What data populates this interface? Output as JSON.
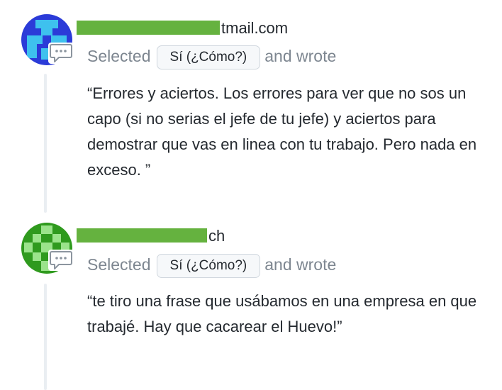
{
  "comments": [
    {
      "user_suffix": "tmail.com",
      "selected_label": "Selected",
      "option_label": "Sí (¿Cómo?)",
      "wrote_label": "and wrote",
      "text": "“Errores y aciertos. Los errores para ver que no sos un capo (si no serias el jefe de tu jefe) y aciertos para demostrar que vas en linea con tu trabajo. Pero nada en exceso. ”",
      "avatar_color": "#2b3bd8",
      "avatar_accent": "#3ec1ee",
      "icon": "comment-bubble-icon"
    },
    {
      "user_suffix": "ch",
      "selected_label": "Selected",
      "option_label": "Sí (¿Cómo?)",
      "wrote_label": "and wrote",
      "text": "“te tiro una frase que usábamos en una empresa en que trabajé. Hay que cacarear el Huevo!”",
      "avatar_color": "#2f9a1e",
      "avatar_accent": "#9be38b",
      "icon": "comment-bubble-icon"
    }
  ],
  "colors": {
    "redaction": "#65b23f",
    "muted_text": "#7d8690",
    "thread_line": "#eaeef2"
  }
}
